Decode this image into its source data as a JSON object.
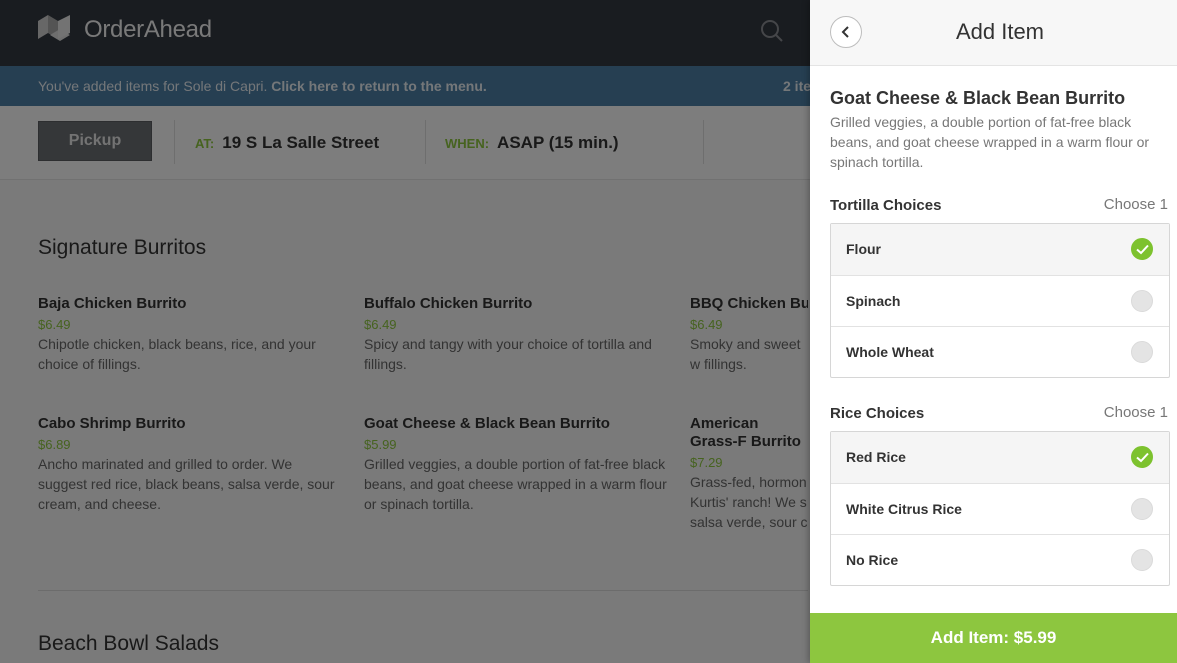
{
  "app": {
    "brand": "OrderAhead"
  },
  "notice": {
    "message_prefix": "You've added items for Sole di Capri.",
    "message_link": "Click here to return to the menu.",
    "count": "2 ite"
  },
  "options": {
    "mode_label": "Pickup",
    "at_key": "AT:",
    "at_value": "19 S La Salle Street",
    "when_key": "WHEN:",
    "when_value": "ASAP (15 min.)"
  },
  "menu": {
    "section_1": "Signature Burritos",
    "section_2": "Beach Bowl Salads",
    "items": [
      {
        "name": "Baja Chicken Burrito",
        "price": "$6.49",
        "desc": "Chipotle chicken, black beans, rice, and your choice of fillings."
      },
      {
        "name": "Buffalo Chicken Burrito",
        "price": "$6.49",
        "desc": "Spicy and tangy with your choice of tortilla and fillings."
      },
      {
        "name": "BBQ Chicken Bur",
        "price": "$6.49",
        "desc": "Smoky and sweet w fillings."
      },
      {
        "name": "Cabo Shrimp Burrito",
        "price": "$6.89",
        "desc": "Ancho marinated and grilled to order. We suggest red rice, black beans, salsa verde, sour cream, and cheese."
      },
      {
        "name": "Goat Cheese & Black Bean Burrito",
        "price": "$5.99",
        "desc": "Grilled veggies, a double portion of fat-free black beans, and goat cheese wrapped in a warm flour or spinach tortilla."
      },
      {
        "name": "American Grass-F Burrito",
        "price": "$7.29",
        "desc": "Grass-fed, hormon Kurtis' ranch! We s salsa verde, sour c"
      }
    ]
  },
  "panel": {
    "title": "Add Item",
    "item_name": "Goat Cheese & Black Bean Burrito",
    "item_desc": "Grilled veggies, a double portion of fat-free black beans, and goat cheese wrapped in a warm flour or spinach tortilla.",
    "groups": [
      {
        "label": "Tortilla Choices",
        "choose": "Choose 1",
        "options": [
          {
            "label": "Flour",
            "selected": true
          },
          {
            "label": "Spinach",
            "selected": false
          },
          {
            "label": "Whole Wheat",
            "selected": false
          }
        ]
      },
      {
        "label": "Rice Choices",
        "choose": "Choose 1",
        "options": [
          {
            "label": "Red Rice",
            "selected": true
          },
          {
            "label": "White Citrus Rice",
            "selected": false
          },
          {
            "label": "No Rice",
            "selected": false
          }
        ]
      }
    ],
    "add_button": "Add Item: $5.99"
  },
  "icons": {
    "logo": "orderahead-logo-icon",
    "search": "search-icon",
    "back": "chevron-left-icon",
    "check": "check-icon"
  },
  "colors": {
    "accent_green": "#8dc63f",
    "check_green": "#7dc22e",
    "topbar": "#333840",
    "notice": "#4c7ea5"
  }
}
